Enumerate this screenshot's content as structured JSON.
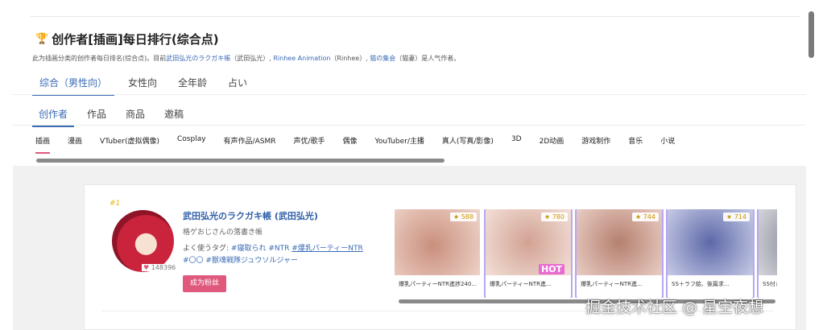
{
  "header": {
    "title": "创作者[插画]每日排行(综合点)",
    "desc_prefix": "此为插画分类的创作者每日排名(综合点)。目前",
    "desc_link1": "武田弘光のラクガキ帳",
    "desc_mid1": "（武田弘光）,",
    "desc_link2": "Rinhee Animation",
    "desc_mid2": "（Rinhee）,",
    "desc_link3": "猫の集会",
    "desc_suffix": "（猫妻）是人气作者。"
  },
  "category_tabs": [
    "综合（男性向）",
    "女性向",
    "全年龄",
    "占い"
  ],
  "type_tabs": [
    "创作者",
    "作品",
    "商品",
    "邀稿"
  ],
  "genre_tabs": [
    "插画",
    "漫画",
    "VTuber(虚拟偶像)",
    "Cosplay",
    "有声作品/ASMR",
    "声优/歌手",
    "偶像",
    "YouTuber/主播",
    "真人(写真/影像)",
    "3D",
    "2D动画",
    "游戏制作",
    "音乐",
    "小说"
  ],
  "creator": {
    "rank": "#1",
    "name": "武田弘光のラクガキ帳 (武田弘光)",
    "subtitle": "格ゲおじさんの落書き帳",
    "tags_label": "よく使うタグ:",
    "tags": [
      "#寝取られ",
      "#NTR",
      "#爆乳パーティーNTR",
      "#〇〇",
      "#獣魂戦隊ジュウソルジャー"
    ],
    "likes": "148396",
    "follow_label": "成为粉丝"
  },
  "works": [
    {
      "count": "588",
      "label": "爆乳パーティーNTR進捗240...",
      "color_a": "#c98f7d",
      "color_b": "#f0d6cc"
    },
    {
      "count": "780",
      "label": "爆乳パーティーNTR進...",
      "color_a": "#d2a293",
      "color_b": "#f3e0d8"
    },
    {
      "count": "744",
      "label": "爆乳パーティーNTR進...",
      "color_a": "#b5806f",
      "color_b": "#e9cdc4"
    },
    {
      "count": "714",
      "label": "SS＋ラフ絵、後篇求...",
      "color_a": "#5d68a8",
      "color_b": "#c7cbe6"
    },
    {
      "count": "",
      "label": "SS付きラ",
      "color_a": "#7d7f8c",
      "color_b": "#d5d6dc"
    }
  ],
  "hot_label": "HOT",
  "watermark": "掘金技术社区 @ 星空夜想"
}
